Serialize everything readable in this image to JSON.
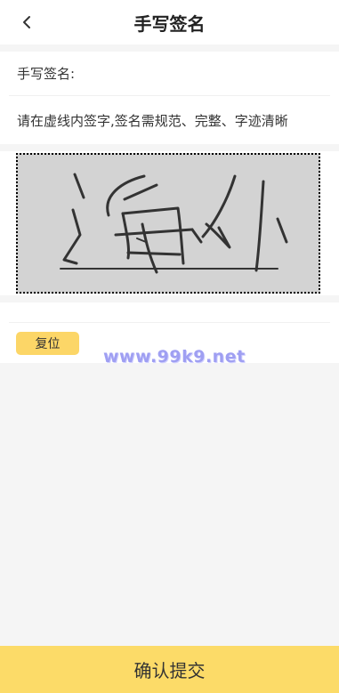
{
  "header": {
    "title": "手写签名",
    "back_icon": "chevron-left-icon"
  },
  "form": {
    "signature_label": "手写签名:",
    "instruction": "请在虚线内签字,签名需规范、完整、字迹清晰"
  },
  "signature_pad": {
    "background_color": "#d3d3d3",
    "stroke_color": "#333333"
  },
  "actions": {
    "reset_label": "复位",
    "submit_label": "确认提交"
  },
  "watermark": {
    "text": "www.99k9.net"
  },
  "colors": {
    "accent": "#fcd667",
    "page_background": "#f5f5f5"
  }
}
